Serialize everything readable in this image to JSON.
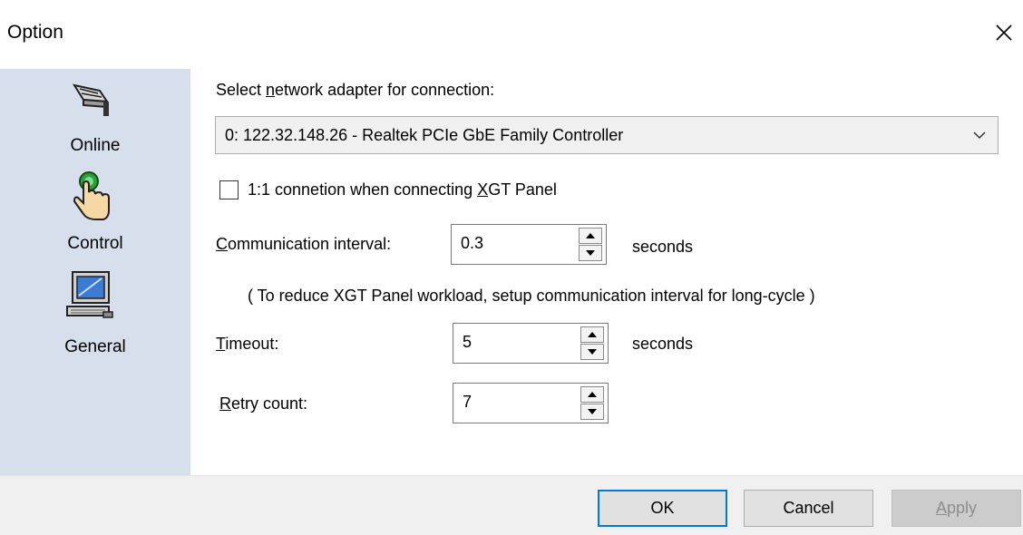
{
  "window": {
    "title": "Option"
  },
  "sidebar": {
    "items": [
      {
        "label": "Online",
        "icon": "network-plug-icon"
      },
      {
        "label": "Control",
        "icon": "hand-pointer-icon"
      },
      {
        "label": "General",
        "icon": "computer-icon"
      }
    ]
  },
  "adapter": {
    "label_pre": "Select ",
    "label_accel": "n",
    "label_post": "etwork adapter for connection:",
    "selected": "0: 122.32.148.26 - Realtek PCIe GbE Family Controller"
  },
  "one_to_one": {
    "label_pre": "1:1 connetion when connecting ",
    "label_accel": "X",
    "label_post": "GT Panel",
    "checked": false
  },
  "comm_interval": {
    "label_accel": "C",
    "label_post": "ommunication interval:",
    "value": "0.3",
    "unit": "seconds",
    "note": "( To reduce XGT Panel workload, setup communication interval for long-cycle )"
  },
  "timeout": {
    "label_accel": "T",
    "label_post": "imeout:",
    "value": "5",
    "unit": "seconds"
  },
  "retry": {
    "label_accel": "R",
    "label_post": "etry count:",
    "value": "7"
  },
  "buttons": {
    "ok": "OK",
    "cancel": "Cancel",
    "apply_accel": "A",
    "apply_post": "pply"
  },
  "colors": {
    "sidebar_bg": "#d8dfec",
    "footer_bg": "#f0f0f0",
    "accent": "#0078d7"
  }
}
